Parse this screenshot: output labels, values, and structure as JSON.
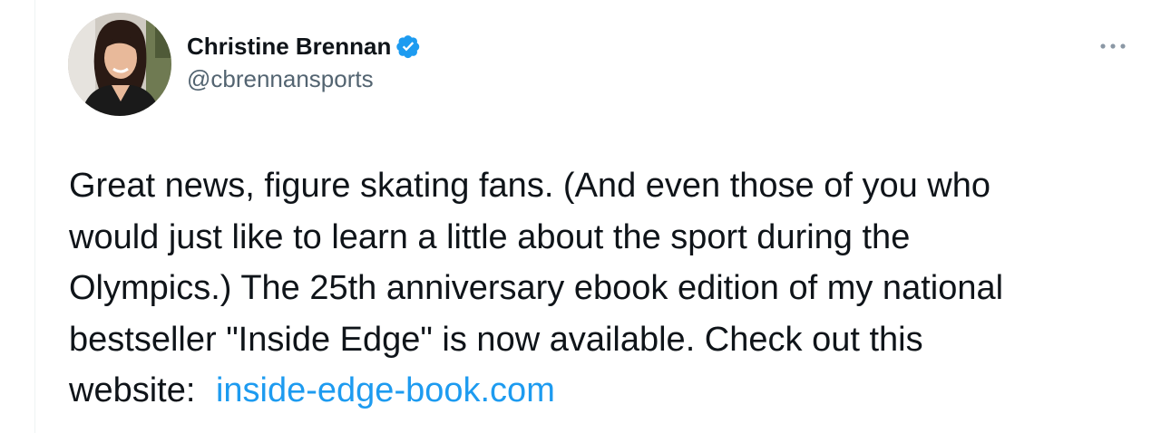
{
  "tweet": {
    "author": {
      "display_name": "Christine Brennan",
      "handle": "@cbrennansports",
      "verified": true,
      "verified_icon": "verified-badge-icon",
      "avatar": "profile-photo"
    },
    "more_icon": "ellipsis-icon",
    "text_lines": [
      "Great news, figure skating fans. (And even those of you who",
      "would just like to learn a little about the sport during the",
      "Olympics.) The 25th anniversary ebook edition of my national",
      "bestseller \"Inside Edge\" is now available. Check out this",
      "website: "
    ],
    "link_text": "inside-edge-book.com"
  },
  "colors": {
    "text": "#0f1419",
    "secondary": "#536471",
    "link": "#1d9bf0",
    "verified": "#1d9bf0"
  }
}
